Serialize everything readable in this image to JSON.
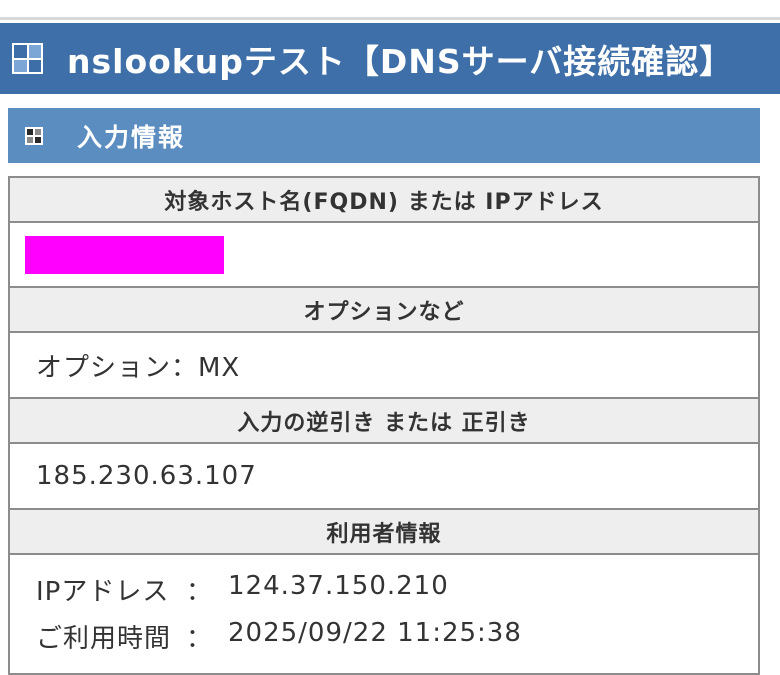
{
  "header": {
    "title": "nslookupテスト【DNSサーバ接続確認】"
  },
  "section": {
    "title": "入力情報"
  },
  "table": {
    "target_header": "対象ホスト名(FQDN) または IPアドレス",
    "options_header": "オプションなど",
    "option_value": "オプション：MX",
    "lookup_header": "入力の逆引き または 正引き",
    "lookup_value": "185.230.63.107",
    "user_header": "利用者情報",
    "user_info": [
      {
        "key": "IPアドレス",
        "sep": "：",
        "value": "124.37.150.210"
      },
      {
        "key": "ご利用時間",
        "sep": "：",
        "value": "2025/09/22 11:25:38"
      }
    ]
  },
  "colors": {
    "header_bg": "#3f6fa8",
    "section_bg": "#5c8dc0",
    "redaction": "#ff00ff"
  },
  "icons": {
    "header_icon": "grid-window-icon",
    "section_icon": "grid-square-icon"
  }
}
